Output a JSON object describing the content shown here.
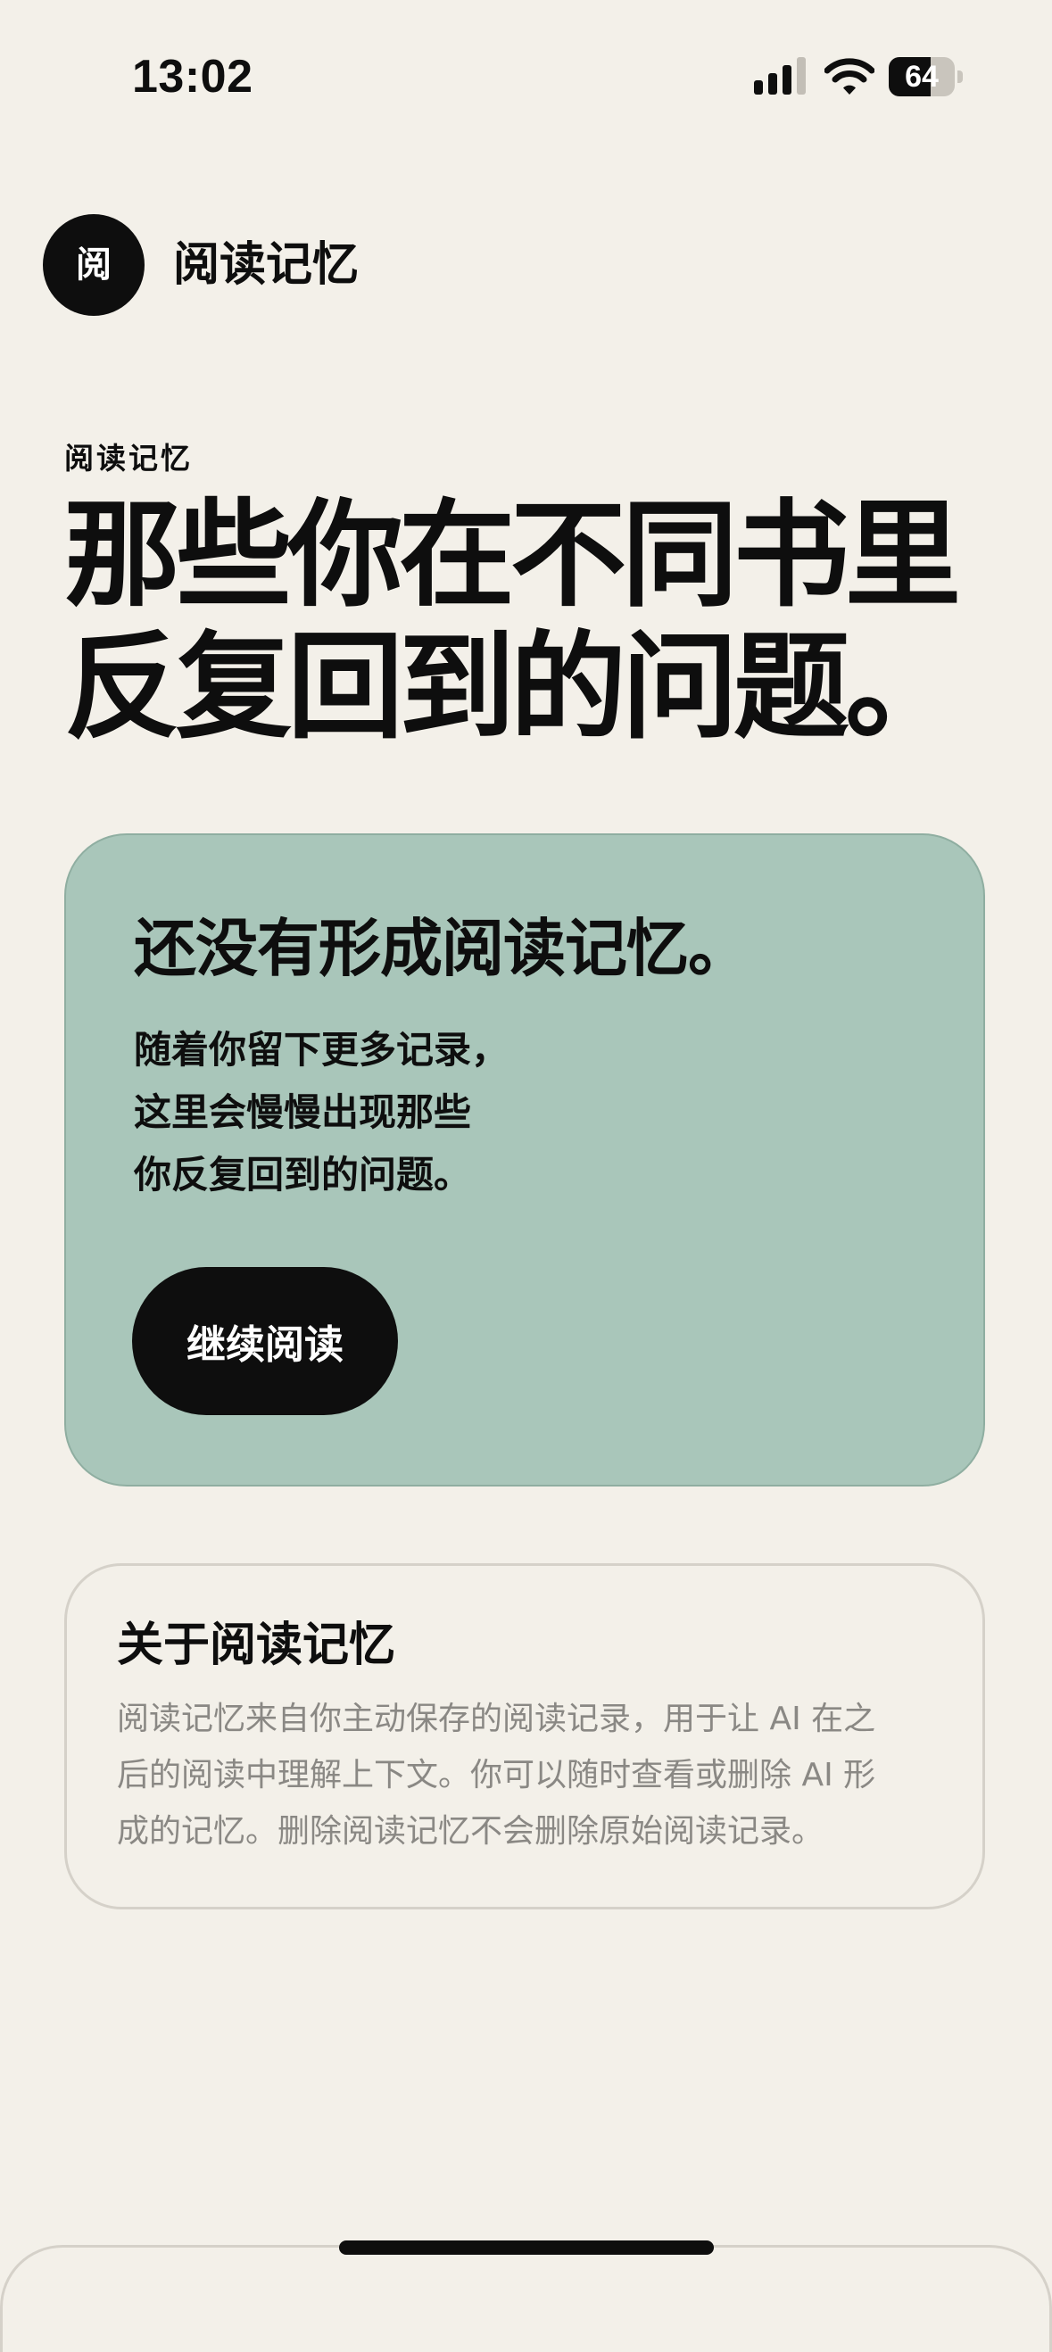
{
  "status_bar": {
    "time": "13:02",
    "icons": [
      "signal-icon",
      "wifi-icon",
      "battery-icon"
    ],
    "battery": {
      "level_text": "64",
      "level_percent": 64
    }
  },
  "header": {
    "logo_glyph": "阅",
    "title": "阅读记忆"
  },
  "hero": {
    "eyebrow": "阅读记忆",
    "title_lines": [
      "那些你在不同书里",
      "反复回到的问题。"
    ]
  },
  "empty_state": {
    "title": "还没有形成阅读记忆。",
    "body_lines": [
      "随着你留下更多记录，",
      "这里会慢慢出现那些",
      "你反复回到的问题。"
    ],
    "button_label": "继续阅读"
  },
  "about": {
    "title": "关于阅读记忆",
    "body_lines": [
      "阅读记忆来自你主动保存的阅读记录，用于让 AI 在之",
      "后的阅读中理解上下文。你可以随时查看或删除 AI 形",
      "成的记忆。删除阅读记忆不会删除原始阅读记录。"
    ]
  },
  "colors": {
    "background": "#F3F0E9",
    "card_green": "#A9C6BA",
    "ink": "#0E0E0E",
    "muted_text": "#8A8884",
    "border": "#D5D1C9"
  }
}
